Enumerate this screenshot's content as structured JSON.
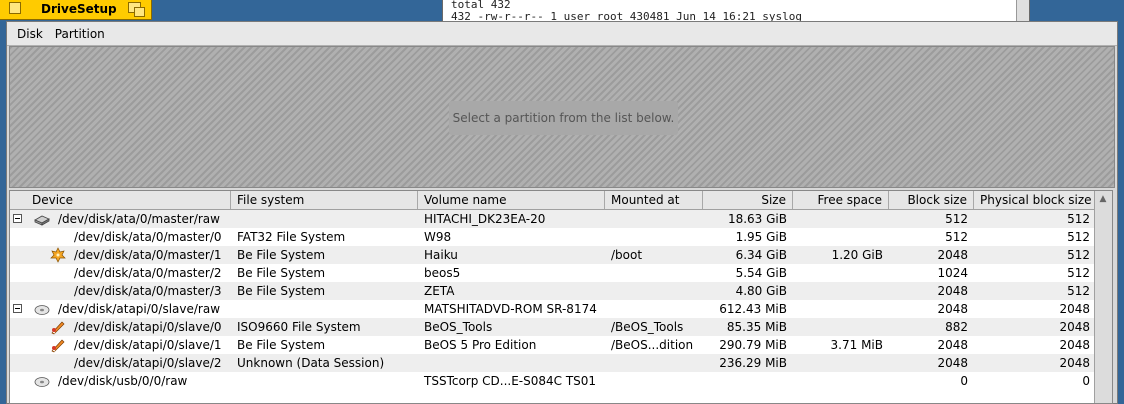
{
  "terminal": {
    "lines": [
      "total 432",
      "432 -rw-r--r-- 1 user root 430481 Jun 14 16:21 syslog"
    ]
  },
  "window": {
    "title": "DriveSetup"
  },
  "menu": {
    "disk": "Disk",
    "partition": "Partition"
  },
  "diskview": {
    "message": "Select a partition from the list below."
  },
  "columns": {
    "device": "Device",
    "filesystem": "File system",
    "volume": "Volume name",
    "mounted": "Mounted at",
    "size": "Size",
    "free": "Free space",
    "block": "Block size",
    "physical": "Physical block size"
  },
  "rows": [
    {
      "device": "/dev/disk/ata/0/master/raw",
      "fs": "",
      "volume": "HITACHI_DK23EA-20",
      "mounted": "",
      "size": "18.63 GiB",
      "free": "",
      "block": "512",
      "physical": "512",
      "icon": "harddisk-icon",
      "level": 0,
      "expander": true
    },
    {
      "device": "/dev/disk/ata/0/master/0",
      "fs": "FAT32 File System",
      "volume": "W98",
      "mounted": "",
      "size": "1.95 GiB",
      "free": "",
      "block": "512",
      "physical": "512",
      "icon": "",
      "level": 1,
      "expander": false
    },
    {
      "device": "/dev/disk/ata/0/master/1",
      "fs": "Be File System",
      "volume": "Haiku",
      "mounted": "/boot",
      "size": "6.34 GiB",
      "free": "1.20 GiB",
      "block": "2048",
      "physical": "512",
      "icon": "haiku-leaf-icon",
      "level": 1,
      "expander": false
    },
    {
      "device": "/dev/disk/ata/0/master/2",
      "fs": "Be File System",
      "volume": "beos5",
      "mounted": "",
      "size": "5.54 GiB",
      "free": "",
      "block": "1024",
      "physical": "512",
      "icon": "",
      "level": 1,
      "expander": false
    },
    {
      "device": "/dev/disk/ata/0/master/3",
      "fs": "Be File System",
      "volume": "ZETA",
      "mounted": "",
      "size": "4.80 GiB",
      "free": "",
      "block": "2048",
      "physical": "512",
      "icon": "",
      "level": 1,
      "expander": false
    },
    {
      "device": "/dev/disk/atapi/0/slave/raw",
      "fs": "",
      "volume": "MATSHITADVD-ROM SR-8174",
      "mounted": "",
      "size": "612.43 MiB",
      "free": "",
      "block": "2048",
      "physical": "2048",
      "icon": "cdrom-icon",
      "level": 0,
      "expander": true
    },
    {
      "device": "/dev/disk/atapi/0/slave/0",
      "fs": "ISO9660 File System",
      "volume": "BeOS_Tools",
      "mounted": "/BeOS_Tools",
      "size": "85.35 MiB",
      "free": "",
      "block": "882",
      "physical": "2048",
      "icon": "mounted-volume-icon",
      "level": 1,
      "expander": false
    },
    {
      "device": "/dev/disk/atapi/0/slave/1",
      "fs": "Be File System",
      "volume": "BeOS 5 Pro Edition",
      "mounted": "/BeOS...dition",
      "size": "290.79 MiB",
      "free": "3.71 MiB",
      "block": "2048",
      "physical": "2048",
      "icon": "mounted-volume-icon",
      "level": 1,
      "expander": false
    },
    {
      "device": "/dev/disk/atapi/0/slave/2",
      "fs": "Unknown (Data Session)",
      "volume": "",
      "mounted": "",
      "size": "236.29 MiB",
      "free": "",
      "block": "2048",
      "physical": "2048",
      "icon": "",
      "level": 1,
      "expander": false
    },
    {
      "device": "/dev/disk/usb/0/0/raw",
      "fs": "",
      "volume": "TSSTcorp CD...E-S084C TS01",
      "mounted": "",
      "size": "",
      "free": "",
      "block": "0",
      "physical": "0",
      "icon": "cdrom-icon",
      "level": 0,
      "expander": false
    }
  ]
}
